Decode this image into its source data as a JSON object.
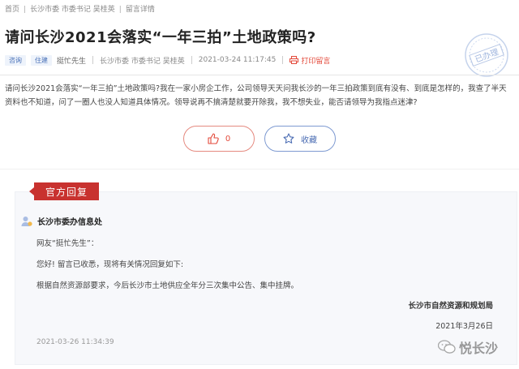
{
  "breadcrumb": [
    "首页",
    "长沙市委 市委书记 吴桂英",
    "留言详情"
  ],
  "title": "请问长沙2021会落实“一年三拍”土地政策吗?",
  "meta": {
    "tags": [
      "咨询",
      "住建"
    ],
    "author": "挺忙先生",
    "target": "长沙市委 市委书记 吴桂英",
    "time": "2021-03-24 11:17:45",
    "print_label": "打印留言"
  },
  "stamp_text": "已办理",
  "content": "请问长沙2021会落实“一年三拍”土地政策吗?我在一家小房企工作，公司领导天天问我长沙的一年三拍政策到底有没有、到底是怎样的，我查了半天资料也不知道，问了一圈人也没人知道具体情况。领导说再不搞清楚就要开除我，我不想失业，能否请领导为我指点迷津?",
  "actions": {
    "like_count": "0",
    "fav_label": "收藏"
  },
  "reply": {
    "tab_label": "官方回复",
    "department": "长沙市委办信息处",
    "greeting": "网友“挺忙先生”：",
    "line1": "您好! 留言已收悉，现将有关情况回复如下:",
    "line2": "根据自然资源部要求，今后长沙市土地供应全年分三次集中公告、集中挂牌。",
    "signature": "长沙市自然资源和规划局",
    "date": "2021年3月26日",
    "time": "2021-03-26 11:34:39"
  },
  "watermark": "悦长沙",
  "colors": {
    "accent_red": "#c8322f",
    "link_blue": "#4a6cb3"
  }
}
